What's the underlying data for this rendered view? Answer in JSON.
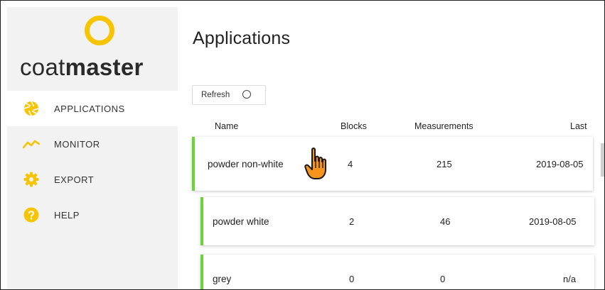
{
  "brand": {
    "logo_text_light": "coat",
    "logo_text_bold": "master"
  },
  "sidebar": {
    "items": [
      {
        "label": "APPLICATIONS",
        "icon": "aperture-icon",
        "active": true
      },
      {
        "label": "MONITOR",
        "icon": "trend-line-icon",
        "active": false
      },
      {
        "label": "EXPORT",
        "icon": "gear-icon",
        "active": false
      },
      {
        "label": "HELP",
        "icon": "question-icon",
        "active": false
      }
    ]
  },
  "main": {
    "title": "Applications",
    "refresh_label": "Refresh",
    "columns": {
      "name": "Name",
      "blocks": "Blocks",
      "measurements": "Measurements",
      "last": "Last"
    },
    "rows": [
      {
        "name_a": "powder",
        "name_b": "non-white",
        "blocks": "4",
        "measurements": "215",
        "last": "2019-08-05"
      },
      {
        "name_a": "powder",
        "name_b": "white",
        "blocks": "2",
        "measurements": "46",
        "last": "2019-08-05"
      },
      {
        "name_a": "grey",
        "name_b": "",
        "blocks": "0",
        "measurements": "0",
        "last": "n/a"
      }
    ]
  },
  "colors": {
    "accent": "#f6c400",
    "row_bar": "#6cd43a",
    "sidebar_bg": "#f2f2f2"
  }
}
